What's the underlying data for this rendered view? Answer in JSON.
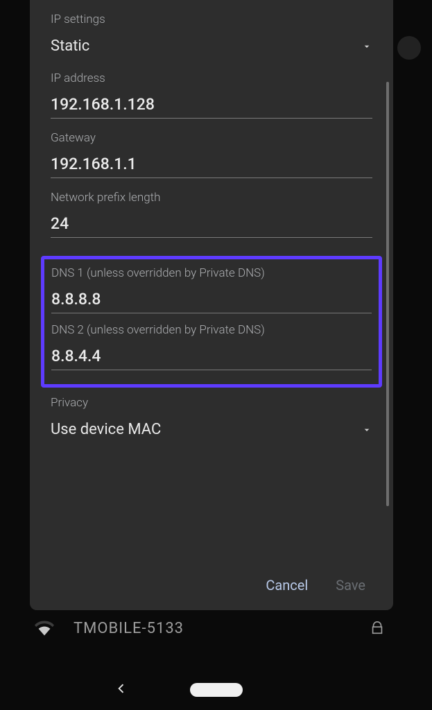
{
  "dialog": {
    "ip_settings_label": "IP settings",
    "ip_settings_value": "Static",
    "ip_address_label": "IP address",
    "ip_address_value": "192.168.1.128",
    "gateway_label": "Gateway",
    "gateway_value": "192.168.1.1",
    "prefix_label": "Network prefix length",
    "prefix_value": "24",
    "dns1_label": "DNS 1 (unless overridden by Private DNS)",
    "dns1_value": "8.8.8.8",
    "dns2_label": "DNS 2 (unless overridden by Private DNS)",
    "dns2_value": "8.8.4.4",
    "privacy_label": "Privacy",
    "privacy_value": "Use device MAC",
    "cancel_label": "Cancel",
    "save_label": "Save"
  },
  "background": {
    "wifi_name": "TMOBILE-5133"
  }
}
